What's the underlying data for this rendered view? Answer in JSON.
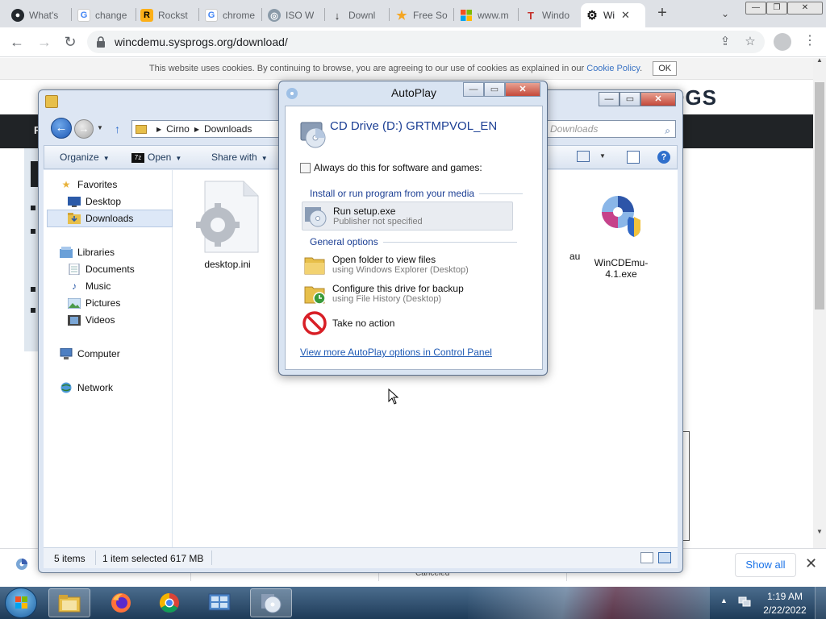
{
  "browser": {
    "tabs": [
      {
        "title": "What's",
        "icon": "github-icon"
      },
      {
        "title": "change",
        "icon": "google-icon"
      },
      {
        "title": "Rockst",
        "icon": "rockstar-icon"
      },
      {
        "title": "chrome",
        "icon": "google-icon"
      },
      {
        "title": "ISO W",
        "icon": "disc-icon"
      },
      {
        "title": "Downl",
        "icon": "download-site-icon"
      },
      {
        "title": "Free So",
        "icon": "star-icon"
      },
      {
        "title": "www.m",
        "icon": "windows-logo-icon"
      },
      {
        "title": "Windo",
        "icon": "t-site-icon"
      },
      {
        "title": "Wi",
        "icon": "gear-icon",
        "active": true
      }
    ],
    "new_tab": "+",
    "url": "wincdemu.sysprogs.org/download/"
  },
  "website": {
    "cookie_text": "This website uses cookies. By continuing to browse, you are agreeing to our use of cookies as explained in our",
    "cookie_link": "Cookie Policy",
    "cookie_period": ".",
    "cookie_ok": "OK",
    "logo_text": "PROGS",
    "nav_label": "F"
  },
  "explorer": {
    "address": {
      "segments": [
        "Cirno",
        "Downloads"
      ]
    },
    "search_placeholder": "Downloads",
    "commands": {
      "organize": "Organize",
      "open": "Open",
      "share": "Share with",
      "seven_zip": "7z"
    },
    "nav": {
      "favorites": "Favorites",
      "desktop": "Desktop",
      "downloads": "Downloads",
      "libraries": "Libraries",
      "documents": "Documents",
      "music": "Music",
      "pictures": "Pictures",
      "videos": "Videos",
      "computer": "Computer",
      "network": "Network"
    },
    "files": {
      "desktop_ini": "desktop.ini",
      "partial_name": "au",
      "wincdemu": "WinCDEmu-4.1.exe"
    },
    "status": {
      "count": "5 items",
      "selected": "1 item selected  617 MB"
    }
  },
  "autoplay": {
    "title": "AutoPlay",
    "drive": "CD Drive (D:) GRTMPVOL_EN",
    "always_label": "Always do this for software and games:",
    "section_install": "Install or run program from your media",
    "run_setup": {
      "title": "Run setup.exe",
      "subtitle": "Publisher not specified"
    },
    "section_general": "General options",
    "open_folder": {
      "title": "Open folder to view files",
      "subtitle": "using Windows Explorer (Desktop)"
    },
    "configure_backup": {
      "title": "Configure this drive for backup",
      "subtitle": "using File History (Desktop)"
    },
    "no_action": {
      "title": "Take no action"
    },
    "more_link": "View more AutoPlay options in Control Panel"
  },
  "download_shelf": {
    "status": "Canceled",
    "show_all": "Show all"
  },
  "taskbar": {
    "time": "1:19 AM",
    "date": "2/22/2022"
  },
  "colors": {
    "accent_link": "#1f5ab4",
    "drive_title": "#1c3f94",
    "chrome_blue": "#1a73e8"
  }
}
